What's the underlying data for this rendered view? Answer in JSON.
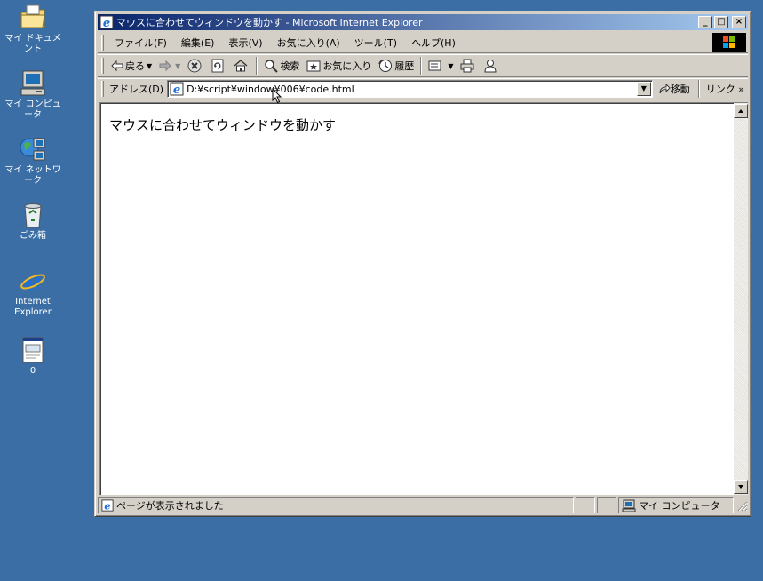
{
  "desktop": {
    "icons": [
      {
        "label": "マイ ドキュメント",
        "icon": "my-documents-icon"
      },
      {
        "label": "マイ コンピュータ",
        "icon": "my-computer-icon"
      },
      {
        "label": "マイ ネットワーク",
        "icon": "my-network-icon"
      },
      {
        "label": "ごみ箱",
        "icon": "recycle-bin-icon"
      },
      {
        "label": "Internet Explorer",
        "icon": "internet-explorer-icon"
      },
      {
        "label": "0",
        "icon": "html-file-icon"
      }
    ],
    "background": "#3a6ea5"
  },
  "window": {
    "title": "マウスに合わせてウィンドウを動かす - Microsoft Internet Explorer",
    "title_gradient_start": "#0a246a",
    "title_gradient_end": "#a6caf0",
    "caption_buttons": {
      "minimize": "_",
      "maximize": "□",
      "close": "×"
    }
  },
  "menubar": {
    "items": [
      {
        "label": "ファイル(F)"
      },
      {
        "label": "編集(E)"
      },
      {
        "label": "表示(V)"
      },
      {
        "label": "お気に入り(A)"
      },
      {
        "label": "ツール(T)"
      },
      {
        "label": "ヘルプ(H)"
      }
    ]
  },
  "toolbar": {
    "back_label": "戻る",
    "search_label": "検索",
    "favorites_label": "お気に入り",
    "history_label": "履歴"
  },
  "addressbar": {
    "label": "アドレス(D)",
    "value": "D:¥script¥window¥006¥code.html",
    "go_label": "移動",
    "links_label": "リンク »"
  },
  "page": {
    "text": "マウスに合わせてウィンドウを動かす"
  },
  "statusbar": {
    "message": "ページが表示されました",
    "zone": "マイ コンピュータ"
  }
}
